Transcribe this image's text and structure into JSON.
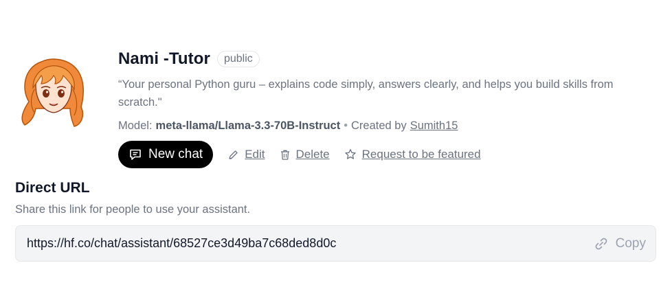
{
  "assistant": {
    "name": "Nami -Tutor",
    "visibility_badge": "public",
    "description": "“Your personal Python guru – explains code simply, answers clearly, and helps you build skills from scratch.\"",
    "model_label": "Model:",
    "model_name": "meta-llama/Llama-3.3-70B-Instruct",
    "separator": "•",
    "created_by_label": "Created by",
    "creator": "Sumith15",
    "avatar_icon": "anime-orange-hair-girl-avatar"
  },
  "actions": {
    "new_chat": "New chat",
    "edit": "Edit",
    "delete": "Delete",
    "request_featured": "Request to be featured"
  },
  "direct_url": {
    "title": "Direct URL",
    "subtitle": "Share this link for people to use your assistant.",
    "url": "https://hf.co/chat/assistant/68527ce3d49ba7c68ded8d0c",
    "copy_label": "Copy"
  },
  "colors": {
    "primary_button_bg": "#000000",
    "muted_text": "#6b7280",
    "url_box_bg": "#f3f4f6",
    "avatar_hair": "#f08a3a"
  }
}
